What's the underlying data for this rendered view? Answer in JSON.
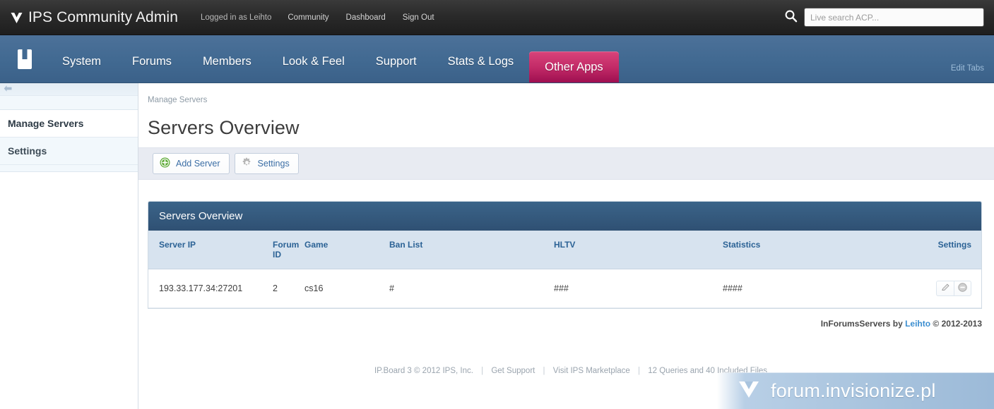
{
  "topbar": {
    "brand": "IPS Community Admin",
    "brand_mark_icon": "ips-triangle-logo-icon",
    "logged_in_as": "Logged in as Leihto",
    "links": [
      {
        "label": "Community"
      },
      {
        "label": "Dashboard"
      },
      {
        "label": "Sign Out"
      }
    ],
    "search": {
      "icon": "search-icon",
      "placeholder": "Live search ACP...",
      "value": ""
    }
  },
  "mainnav": {
    "app_logo_icon": "book-app-icon",
    "items": [
      {
        "label": "System",
        "active": false
      },
      {
        "label": "Forums",
        "active": false
      },
      {
        "label": "Members",
        "active": false
      },
      {
        "label": "Look & Feel",
        "active": false
      },
      {
        "label": "Support",
        "active": false
      },
      {
        "label": "Stats & Logs",
        "active": false
      },
      {
        "label": "Other Apps",
        "active": true
      }
    ],
    "edit_tabs": "Edit Tabs",
    "active_color": "#c22a67",
    "bar_color": "#426a92"
  },
  "sidebar": {
    "collapse_icon": "collapse-left-arrow-icon",
    "items": [
      {
        "label": "Manage Servers",
        "active": true
      },
      {
        "label": "Settings",
        "active": false
      }
    ]
  },
  "main": {
    "breadcrumb": "Manage Servers",
    "page_title": "Servers Overview",
    "toolbar": {
      "add_server_label": "Add Server",
      "add_server_icon": "plus-circle-green-icon",
      "settings_label": "Settings",
      "settings_icon": "gear-icon"
    },
    "panel": {
      "title": "Servers Overview",
      "columns": [
        "Server IP",
        "Forum ID",
        "Game",
        "Ban List",
        "HLTV",
        "Statistics",
        "Settings"
      ],
      "rows": [
        {
          "server_ip": "193.33.177.34:27201",
          "forum_id": "2",
          "game": "cs16",
          "ban_list": "#",
          "hltv": "###",
          "statistics": "####",
          "edit_icon": "pencil-edit-icon",
          "delete_icon": "minus-circle-delete-icon"
        }
      ]
    },
    "credits": {
      "prefix": "InForumsServers by ",
      "author": "Leihto",
      "suffix": " © 2012-2013"
    }
  },
  "footer": {
    "copyright": "IP.Board 3 © 2012 IPS, Inc.",
    "links": [
      {
        "label": "Get Support"
      },
      {
        "label": "Visit IPS Marketplace"
      }
    ],
    "stats": "12 Queries and 40 Included Files",
    "separator": "|"
  },
  "watermark": {
    "text": "forum.invisionize.pl",
    "icon": "ips-triangle-logo-icon"
  }
}
